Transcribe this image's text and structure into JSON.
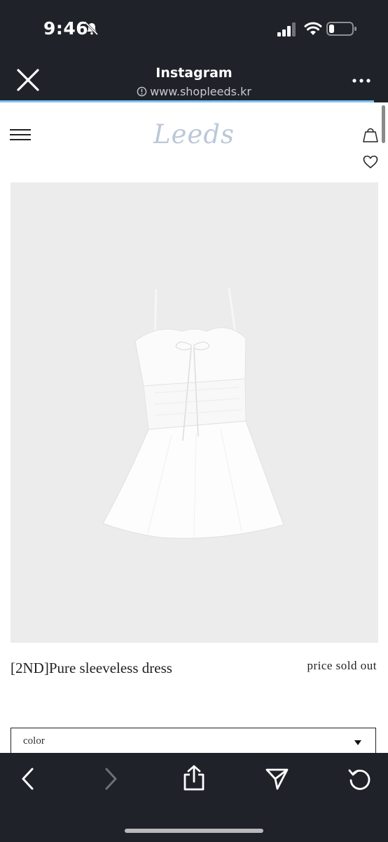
{
  "status": {
    "time": "9:46"
  },
  "browser": {
    "app_title": "Instagram",
    "url": "www.shopleeds.kr"
  },
  "site": {
    "logo": "Leeds"
  },
  "product": {
    "name": "[2ND]Pure sleeveless dress",
    "price": "price sold out",
    "option_label": "color"
  },
  "icons": {
    "close": "close-icon",
    "more": "more-icon",
    "menu": "hamburger-icon",
    "bag": "bag-icon",
    "heart": "heart-icon",
    "back": "chevron-left-icon",
    "forward": "chevron-right-icon",
    "share": "share-icon",
    "send": "send-icon",
    "reload": "reload-icon"
  },
  "colors": {
    "chrome": "#1f2229",
    "logo": "#bcc8d8",
    "progress": "#7cc0f5"
  }
}
